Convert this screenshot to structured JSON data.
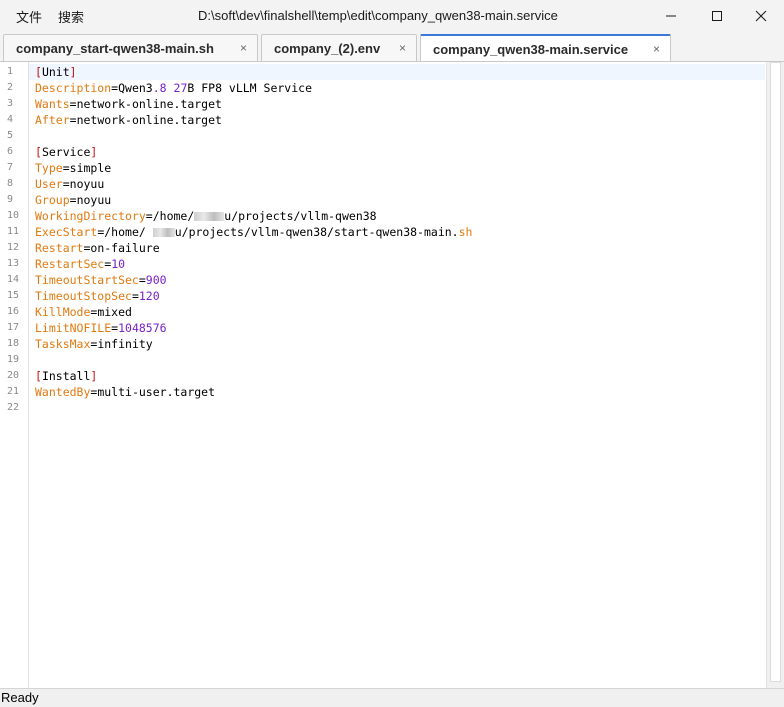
{
  "menu": {
    "file": "文件",
    "search": "搜索"
  },
  "window": {
    "title": "D:\\soft\\dev\\finalshell\\temp\\edit\\company_qwen38-main.service"
  },
  "tabs": [
    {
      "label": "company_start-qwen38-main.sh",
      "close": "×"
    },
    {
      "label": "company_(2).env",
      "close": "×"
    },
    {
      "label": "company_qwen38-main.service",
      "close": "×",
      "active": true
    }
  ],
  "editor": {
    "line_numbers": [
      "1",
      "2",
      "3",
      "4",
      "5",
      "6",
      "7",
      "8",
      "9",
      "10",
      "11",
      "12",
      "13",
      "14",
      "15",
      "16",
      "17",
      "18",
      "19",
      "20",
      "21",
      "22"
    ],
    "lines": {
      "l1": {
        "open": "[",
        "section": "Unit",
        "close": "]"
      },
      "l2": {
        "key": "Description",
        "eq": "=",
        "v1": "Qwen3",
        "v2": ".8 ",
        "v3": "27",
        "v4": "B FP8 vLLM Service"
      },
      "l3": {
        "key": "Wants",
        "eq": "=",
        "value": "network-online.target"
      },
      "l4": {
        "key": "After",
        "eq": "=",
        "value": "network-online.target"
      },
      "l6": {
        "open": "[",
        "section": "Service",
        "close": "]"
      },
      "l7": {
        "key": "Type",
        "eq": "=",
        "value": "simple"
      },
      "l8": {
        "key": "User",
        "eq": "=",
        "value": "noyuu"
      },
      "l9": {
        "key": "Group",
        "eq": "=",
        "value": "noyuu"
      },
      "l10": {
        "key": "WorkingDirectory",
        "eq": "=",
        "pre": "/home/",
        "post": "u/projects/vllm-qwen38"
      },
      "l11": {
        "key": "ExecStart",
        "eq": "=",
        "pre": "/home/ ",
        "post": "u/projects/vllm-qwen38/start-qwen38-main.",
        "ext": "sh"
      },
      "l12": {
        "key": "Restart",
        "eq": "=",
        "value": "on-failure"
      },
      "l13": {
        "key": "RestartSec",
        "eq": "=",
        "value": "10"
      },
      "l14": {
        "key": "TimeoutStartSec",
        "eq": "=",
        "value": "900"
      },
      "l15": {
        "key": "TimeoutStopSec",
        "eq": "=",
        "value": "120"
      },
      "l16": {
        "key": "KillMode",
        "eq": "=",
        "value": "mixed"
      },
      "l17": {
        "key": "LimitNOFILE",
        "eq": "=",
        "value": "1048576"
      },
      "l18": {
        "key": "TasksMax",
        "eq": "=",
        "value": "infinity"
      },
      "l20": {
        "open": "[",
        "section": "Install",
        "close": "]"
      },
      "l21": {
        "key": "WantedBy",
        "eq": "=",
        "value": "multi-user.target"
      }
    }
  },
  "status": {
    "text": "Ready"
  },
  "colors": {
    "key": "#e07a10",
    "bracket": "#c81414",
    "number": "#7a22c8",
    "accent": "#3c78d8"
  }
}
